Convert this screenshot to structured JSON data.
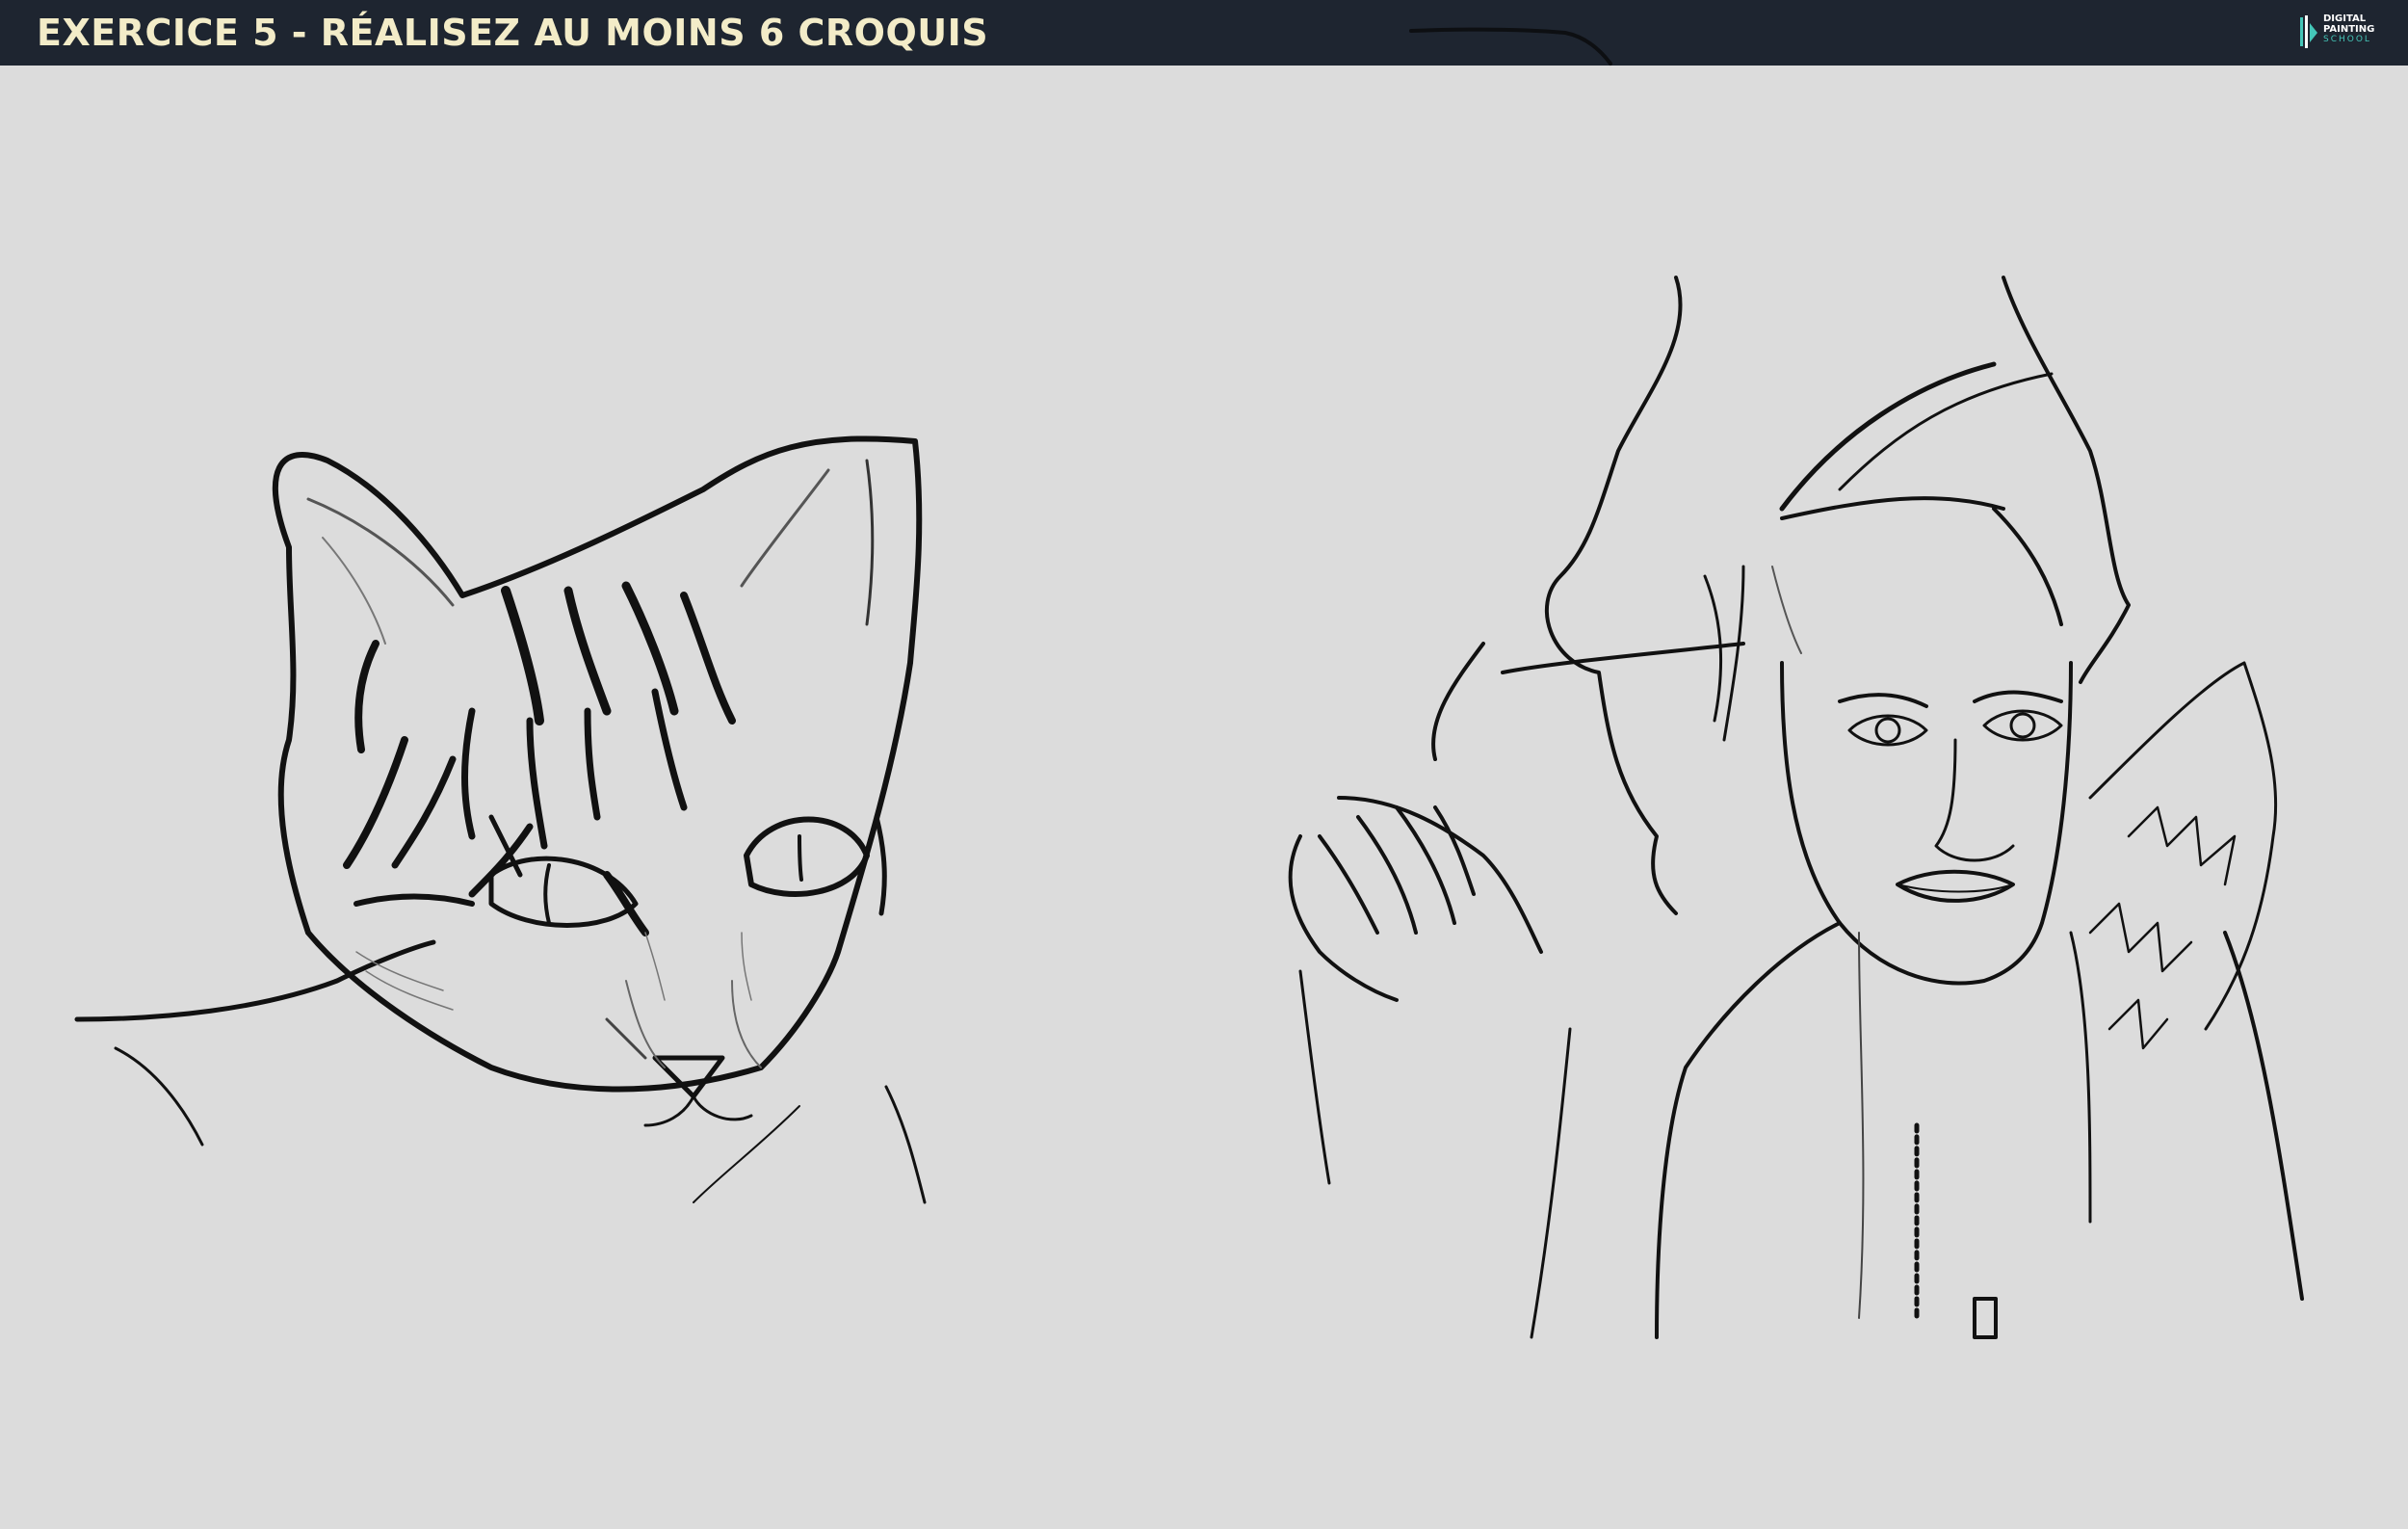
{
  "header": {
    "title": "EXERCICE 5 - RÉALISEZ AU MOINS 6 CROQUIS",
    "background_color": "#1e2530",
    "title_color": "#f3ecc8"
  },
  "logo": {
    "line1": "DIGITAL",
    "line2": "PAINTING",
    "line3": "SCHOOL",
    "accent_color": "#44c6b8"
  },
  "canvas": {
    "background_color": "#dcdcdc",
    "sketches": [
      {
        "subject": "cat-head-sketch",
        "icon": "cat-sketch-icon"
      },
      {
        "subject": "woman-portrait-sketch",
        "icon": "woman-sketch-icon"
      }
    ]
  }
}
